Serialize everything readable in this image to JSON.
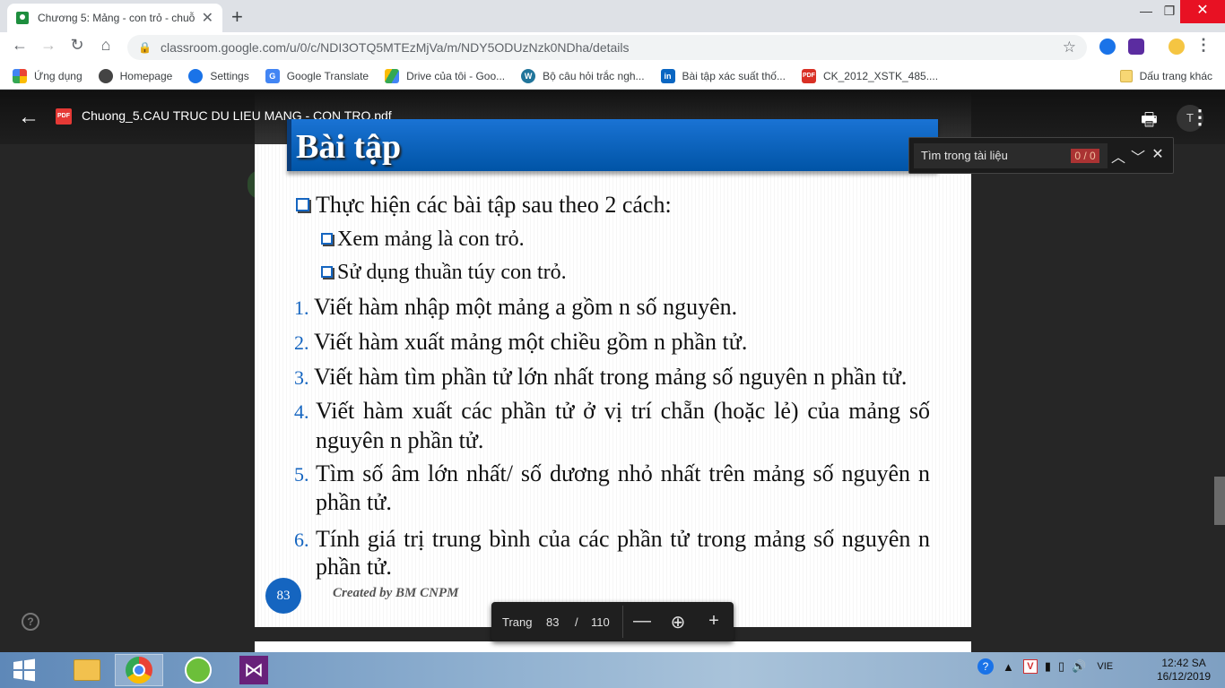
{
  "browser": {
    "tab_title": "Chương 5: Mảng - con trỏ - chuỗ",
    "tab_close": "✕",
    "new_tab": "+",
    "window_controls": {
      "minimize": "—",
      "maximize": "❐",
      "close": "✕"
    },
    "url": "classroom.google.com/u/0/c/NDI3OTQ5MTEzMjVa/m/NDY5ODUzNzk0NDha/details",
    "nav": {
      "back": "←",
      "forward": "→",
      "reload": "↻",
      "home": "⌂",
      "lock": "🔒",
      "star": "☆"
    },
    "bookmarks": [
      {
        "label": "Ứng dụng",
        "icon": "apps-grid-icon"
      },
      {
        "label": "Homepage",
        "icon": "globe-icon"
      },
      {
        "label": "Settings",
        "icon": "gear-icon"
      },
      {
        "label": "Google Translate",
        "icon": "translate-icon"
      },
      {
        "label": "Drive của tôi - Goo...",
        "icon": "drive-icon"
      },
      {
        "label": "Bộ câu hỏi trắc ngh...",
        "icon": "wordpress-icon"
      },
      {
        "label": "Bài tập xác suất thố...",
        "icon": "linkedin-icon"
      },
      {
        "label": "CK_2012_XSTK_485....",
        "icon": "pdf-icon"
      }
    ],
    "bookmarks_other": "Dấu trang khác"
  },
  "viewer": {
    "back": "←",
    "file_icon": "PDF",
    "filename": "Chuong_5.CAU TRUC DU LIEU MANG - CON TRO.pdf",
    "print": "🖶",
    "avatar": "T",
    "more": "⋮",
    "find": {
      "placeholder": "Tìm trong tài liệu",
      "count": "0 / 0",
      "prev": "︿",
      "next": "﹀",
      "close": "✕"
    },
    "pager": {
      "label": "Trang",
      "current": "83",
      "separator": "/",
      "total": "110",
      "zoom_out": "—",
      "zoom_fit": "⊕",
      "zoom_in": "+"
    },
    "help": "?"
  },
  "slide": {
    "title": "Bài tập",
    "intro": "Thực hiện các bài tập sau theo 2 cách:",
    "methods": [
      "Xem mảng là con trỏ.",
      "Sử dụng thuần túy con trỏ."
    ],
    "exercises": [
      {
        "num": "1.",
        "lines": [
          "Viết hàm nhập một mảng a gồm n số nguyên."
        ]
      },
      {
        "num": "2.",
        "lines": [
          "Viết hàm xuất mảng một chiều gồm n phần tử."
        ]
      },
      {
        "num": "3.",
        "lines": [
          "Viết hàm tìm phần tử lớn nhất trong mảng số nguyên n phần tử."
        ]
      },
      {
        "num": "4.",
        "lines": [
          "Viết hàm xuất các phần tử ở vị trí chẵn (hoặc lẻ) của mảng số",
          "nguyên n phần tử."
        ]
      },
      {
        "num": "5.",
        "lines": [
          "Tìm số âm lớn nhất/ số dương nhỏ nhất trên mảng số nguyên n",
          "phần tử."
        ]
      },
      {
        "num": "6.",
        "lines": [
          "Tính giá trị trung bình của các phần tử trong mảng số nguyên n",
          "phần tử."
        ]
      }
    ],
    "page_number": "83",
    "credit": "Created by BM CNPM"
  },
  "taskbar": {
    "language": "VIE",
    "time": "12:42 SA",
    "date": "16/12/2019"
  }
}
